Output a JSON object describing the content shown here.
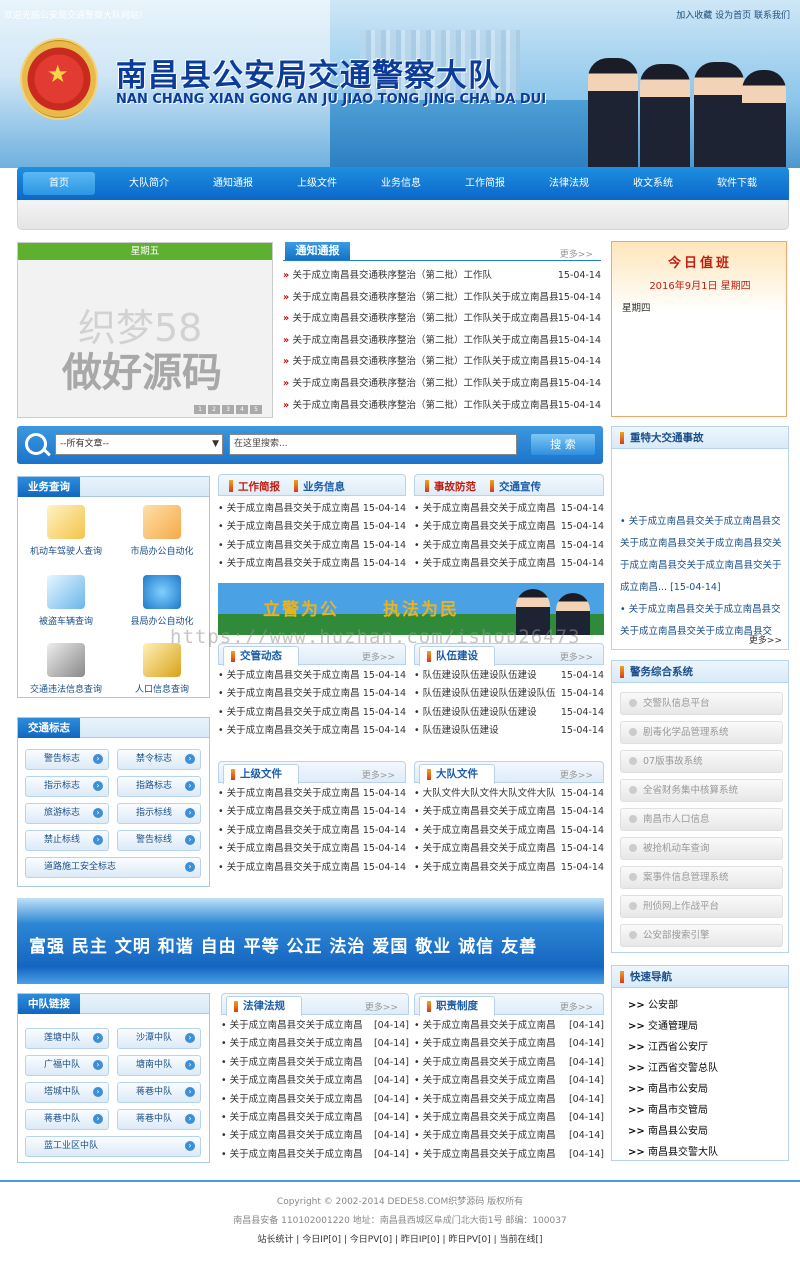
{
  "header": {
    "welcome": "欢迎光临公安局交通警察大队网站!",
    "top_links": "加入收藏 设为首页 联系我们",
    "title": "南昌县公安局交通警察大队",
    "subtitle": "NAN CHANG XIAN GONG AN JU JIAO TONG JING CHA DA DUI"
  },
  "nav": [
    "首页",
    "大队简介",
    "通知通报",
    "上级文件",
    "业务信息",
    "工作简报",
    "法律法规",
    "收文系统",
    "软件下载"
  ],
  "slide": {
    "day": "星期五",
    "text1": "织梦58",
    "text2": "做好源码",
    "dots": [
      "1",
      "2",
      "3",
      "4",
      "5"
    ]
  },
  "notice": {
    "tab": "通知通报",
    "more": "更多>>",
    "items": [
      {
        "title": "关于成立南昌县交通秩序整治（第二批）工作队",
        "date": "15-04-14"
      },
      {
        "title": "关于成立南昌县交通秩序整治（第二批）工作队关于成立南昌县",
        "date": "15-04-14"
      },
      {
        "title": "关于成立南昌县交通秩序整治（第二批）工作队关于成立南昌县",
        "date": "15-04-14"
      },
      {
        "title": "关于成立南昌县交通秩序整治（第二批）工作队关于成立南昌县",
        "date": "15-04-14"
      },
      {
        "title": "关于成立南昌县交通秩序整治（第二批）工作队关于成立南昌县",
        "date": "15-04-14"
      },
      {
        "title": "关于成立南昌县交通秩序整治（第二批）工作队关于成立南昌县",
        "date": "15-04-14"
      },
      {
        "title": "关于成立南昌县交通秩序整治（第二批）工作队关于成立南昌县",
        "date": "15-04-14"
      }
    ]
  },
  "duty": {
    "title": "今日值班",
    "date": "2016年9月1日 星期四",
    "weekday": "星期四"
  },
  "search": {
    "select": "--所有文章--",
    "placeholder": "在这里搜索...",
    "button": "搜 索"
  },
  "biz": {
    "title": "业务查询",
    "items": [
      "机动车驾驶人查询",
      "市局办公自动化",
      "被盗车辆查询",
      "县局办公自动化",
      "交通违法信息查询",
      "人口信息查询"
    ]
  },
  "sign": {
    "title": "交通标志",
    "items": [
      "警告标志",
      "禁令标志",
      "指示标志",
      "指路标志",
      "旅游标志",
      "指示标线",
      "禁止标线",
      "警告标线",
      "道路施工安全标志"
    ]
  },
  "blockA": {
    "t1": "工作简报",
    "t2": "业务信息",
    "items": [
      {
        "title": "关于成立南昌县交关于成立南昌",
        "date": "15-04-14"
      },
      {
        "title": "关于成立南昌县交关于成立南昌",
        "date": "15-04-14"
      },
      {
        "title": "关于成立南昌县交关于成立南昌",
        "date": "15-04-14"
      },
      {
        "title": "关于成立南昌县交关于成立南昌",
        "date": "15-04-14"
      }
    ]
  },
  "blockB": {
    "t1": "事故防范",
    "t2": "交通宣传",
    "items": [
      {
        "title": "关于成立南昌县交关于成立南昌",
        "date": "15-04-14"
      },
      {
        "title": "关于成立南昌县交关于成立南昌",
        "date": "15-04-14"
      },
      {
        "title": "关于成立南昌县交关于成立南昌",
        "date": "15-04-14"
      },
      {
        "title": "关于成立南昌县交关于成立南昌",
        "date": "15-04-14"
      }
    ]
  },
  "banner1": {
    "text1": "立警为公",
    "text2": "执法为民"
  },
  "watermark": "https://www.huzhan.com/ishop26473",
  "blockC": {
    "tab": "交管动态",
    "more": "更多>>",
    "items": [
      {
        "title": "关于成立南昌县交关于成立南昌",
        "date": "15-04-14"
      },
      {
        "title": "关于成立南昌县交关于成立南昌",
        "date": "15-04-14"
      },
      {
        "title": "关于成立南昌县交关于成立南昌",
        "date": "15-04-14"
      },
      {
        "title": "关于成立南昌县交关于成立南昌",
        "date": "15-04-14"
      }
    ]
  },
  "blockD": {
    "tab": "队伍建设",
    "more": "更多>>",
    "items": [
      {
        "title": "队伍建设队伍建设队伍建设",
        "date": "15-04-14"
      },
      {
        "title": "队伍建设队伍建设队伍建设队伍",
        "date": "15-04-14"
      },
      {
        "title": "队伍建设队伍建设队伍建设",
        "date": "15-04-14"
      },
      {
        "title": "队伍建设队伍建设",
        "date": "15-04-14"
      }
    ]
  },
  "blockE": {
    "tab": "上级文件",
    "more": "更多>>",
    "items": [
      {
        "title": "关于成立南昌县交关于成立南昌",
        "date": "15-04-14"
      },
      {
        "title": "关于成立南昌县交关于成立南昌",
        "date": "15-04-14"
      },
      {
        "title": "关于成立南昌县交关于成立南昌",
        "date": "15-04-14"
      },
      {
        "title": "关于成立南昌县交关于成立南昌",
        "date": "15-04-14"
      },
      {
        "title": "关于成立南昌县交关于成立南昌",
        "date": "15-04-14"
      }
    ]
  },
  "blockF": {
    "tab": "大队文件",
    "more": "更多>>",
    "items": [
      {
        "title": "大队文件大队文件大队文件大队",
        "date": "15-04-14"
      },
      {
        "title": "关于成立南昌县交关于成立南昌",
        "date": "15-04-14"
      },
      {
        "title": "关于成立南昌县交关于成立南昌",
        "date": "15-04-14"
      },
      {
        "title": "关于成立南昌县交关于成立南昌",
        "date": "15-04-14"
      },
      {
        "title": "关于成立南昌县交关于成立南昌",
        "date": "15-04-14"
      }
    ]
  },
  "banner2": {
    "text": "富强 民主 文明 和谐 自由 平等 公正 法治 爱国 敬业 诚信 友善"
  },
  "team": {
    "title": "中队链接",
    "items": [
      "莲塘中队",
      "沙潭中队",
      "广福中队",
      "塘南中队",
      "塔城中队",
      "蒋巷中队",
      "蒋巷中队",
      "蒋巷中队",
      "蓝工业区中队"
    ]
  },
  "blockG": {
    "tab": "法律法规",
    "more": "更多>>",
    "items": [
      {
        "title": "关于成立南昌县交关于成立南昌",
        "date": "[04-14]"
      },
      {
        "title": "关于成立南昌县交关于成立南昌",
        "date": "[04-14]"
      },
      {
        "title": "关于成立南昌县交关于成立南昌",
        "date": "[04-14]"
      },
      {
        "title": "关于成立南昌县交关于成立南昌",
        "date": "[04-14]"
      },
      {
        "title": "关于成立南昌县交关于成立南昌",
        "date": "[04-14]"
      },
      {
        "title": "关于成立南昌县交关于成立南昌",
        "date": "[04-14]"
      },
      {
        "title": "关于成立南昌县交关于成立南昌",
        "date": "[04-14]"
      },
      {
        "title": "关于成立南昌县交关于成立南昌",
        "date": "[04-14]"
      }
    ]
  },
  "blockH": {
    "tab": "职责制度",
    "more": "更多>>",
    "items": [
      {
        "title": "关于成立南昌县交关于成立南昌",
        "date": "[04-14]"
      },
      {
        "title": "关于成立南昌县交关于成立南昌",
        "date": "[04-14]"
      },
      {
        "title": "关于成立南昌县交关于成立南昌",
        "date": "[04-14]"
      },
      {
        "title": "关于成立南昌县交关于成立南昌",
        "date": "[04-14]"
      },
      {
        "title": "关于成立南昌县交关于成立南昌",
        "date": "[04-14]"
      },
      {
        "title": "关于成立南昌县交关于成立南昌",
        "date": "[04-14]"
      },
      {
        "title": "关于成立南昌县交关于成立南昌",
        "date": "[04-14]"
      },
      {
        "title": "关于成立南昌县交关于成立南昌",
        "date": "[04-14]"
      }
    ]
  },
  "accident": {
    "title": "重特大交通事故",
    "text": "• 关于成立南昌县交关于成立南昌县交关于成立南昌县交关于成立南昌县交关于成立南昌县交关于成立南昌县交关于成立南昌... [15-04-14]",
    "text2": "• 关于成立南昌县交关于成立南昌县交关于成立南昌县交关于成立南昌县交",
    "more": "更多>>"
  },
  "sys": {
    "title": "警务综合系统",
    "items": [
      "交警队信息平台",
      "剧毒化学品管理系统",
      "07版事故系统",
      "全省财务集中核算系统",
      "南昌市人口信息",
      "被抢机动车查询",
      "案事件信息管理系统",
      "刑侦网上作战平台",
      "公安部搜索引擎"
    ]
  },
  "quick": {
    "title": "快速导航",
    "prefix": ">>",
    "items": [
      "公安部",
      "交通管理局",
      "江西省公安厅",
      "江西省交警总队",
      "南昌市公安局",
      "南昌市交管局",
      "南昌县公安局",
      "南昌县交警大队"
    ]
  },
  "footer": {
    "line1": "Copyright © 2002-2014 DEDE58.COM织梦源码 版权所有",
    "line2": "南昌县安备 110102001220 地址：南昌县西城区阜成门北大街1号 邮编：100037",
    "line3": "站长统计 | 今日IP[0] | 今日PV[0] | 昨日IP[0] | 昨日PV[0] | 当前在线[]"
  }
}
